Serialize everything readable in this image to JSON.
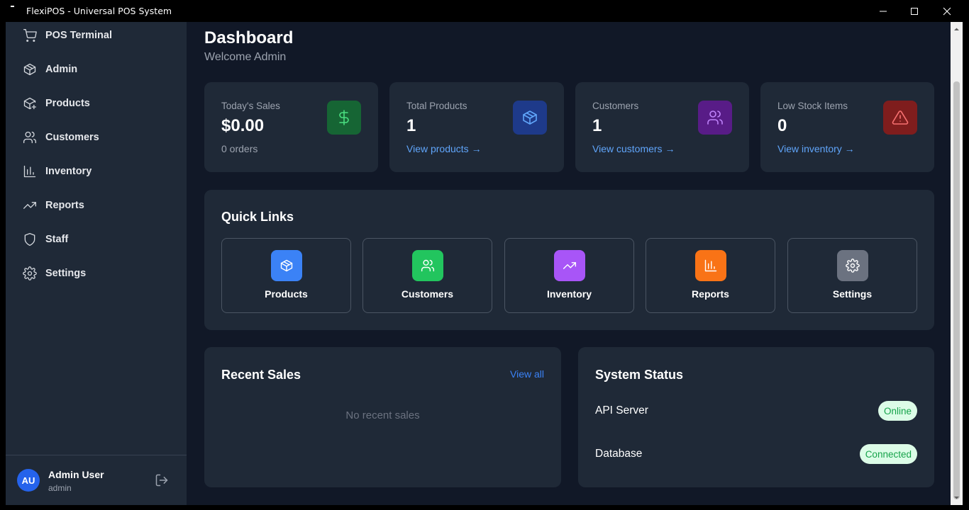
{
  "window": {
    "title": "FlexiPOS - Universal POS System"
  },
  "sidebar": {
    "items": [
      {
        "label": "POS Terminal",
        "icon": "cart-icon"
      },
      {
        "label": "Admin",
        "icon": "package-icon"
      },
      {
        "label": "Products",
        "icon": "package-plus-icon"
      },
      {
        "label": "Customers",
        "icon": "users-icon"
      },
      {
        "label": "Inventory",
        "icon": "bar-chart-icon"
      },
      {
        "label": "Reports",
        "icon": "trending-up-icon"
      },
      {
        "label": "Staff",
        "icon": "shield-icon"
      },
      {
        "label": "Settings",
        "icon": "gear-icon"
      }
    ],
    "user": {
      "initials": "AU",
      "name": "Admin User",
      "role": "admin"
    }
  },
  "header": {
    "title": "Dashboard",
    "subtitle": "Welcome Admin"
  },
  "stats": [
    {
      "label": "Today's Sales",
      "value": "$0.00",
      "sub": "0 orders",
      "icon": "dollar-icon",
      "color": "#166534"
    },
    {
      "label": "Total Products",
      "value": "1",
      "link": "View products →",
      "icon": "package-icon",
      "color": "#1e3a8a"
    },
    {
      "label": "Customers",
      "value": "1",
      "link": "View customers →",
      "icon": "users-icon",
      "color": "#581c87"
    },
    {
      "label": "Low Stock Items",
      "value": "0",
      "link": "View inventory →",
      "icon": "alert-triangle-icon",
      "color": "#7f1d1d"
    }
  ],
  "quick_links": {
    "title": "Quick Links",
    "items": [
      {
        "label": "Products",
        "icon": "package-icon",
        "color": "#3b82f6"
      },
      {
        "label": "Customers",
        "icon": "users-icon",
        "color": "#22c55e"
      },
      {
        "label": "Inventory",
        "icon": "trending-up-icon",
        "color": "#a855f7"
      },
      {
        "label": "Reports",
        "icon": "bar-chart-icon",
        "color": "#f97316"
      },
      {
        "label": "Settings",
        "icon": "gear-icon",
        "color": "#6b7280"
      }
    ]
  },
  "recent_sales": {
    "title": "Recent Sales",
    "view_all": "View all",
    "empty": "No recent sales"
  },
  "system_status": {
    "title": "System Status",
    "rows": [
      {
        "label": "API Server",
        "status": "Online"
      },
      {
        "label": "Database",
        "status": "Connected"
      }
    ]
  }
}
